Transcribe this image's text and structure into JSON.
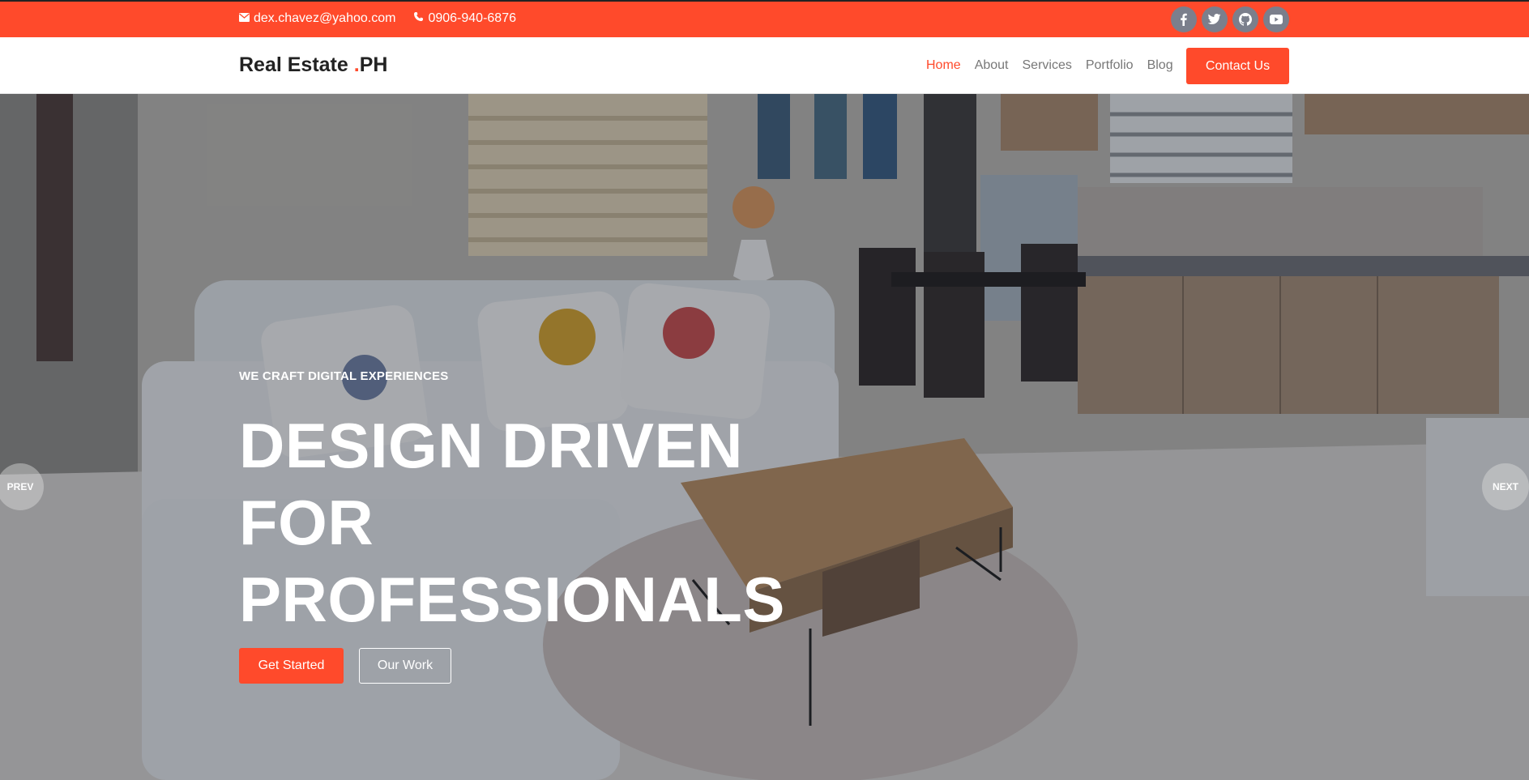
{
  "topbar": {
    "email": "dex.chavez@yahoo.com",
    "phone": "0906-940-6876",
    "socials": [
      "facebook-icon",
      "twitter-icon",
      "github-icon",
      "youtube-icon"
    ]
  },
  "header": {
    "logo_main": "Real Estate ",
    "logo_dot": ".",
    "logo_suffix": "PH",
    "nav": [
      "Home",
      "About",
      "Services",
      "Portfolio",
      "Blog"
    ],
    "contact_label": "Contact Us"
  },
  "hero": {
    "eyebrow": "WE CRAFT DIGITAL EXPERIENCES",
    "headline_line1": "DESIGN DRIVEN FOR",
    "headline_line2": "PROFESSIONALS",
    "primary_cta": "Get Started",
    "secondary_cta": "Our Work",
    "prev_label": "PREV",
    "next_label": "NEXT"
  },
  "colors": {
    "accent": "#ff4a2b",
    "nav_text": "#777777",
    "social_bg": "#7b7f8c"
  }
}
